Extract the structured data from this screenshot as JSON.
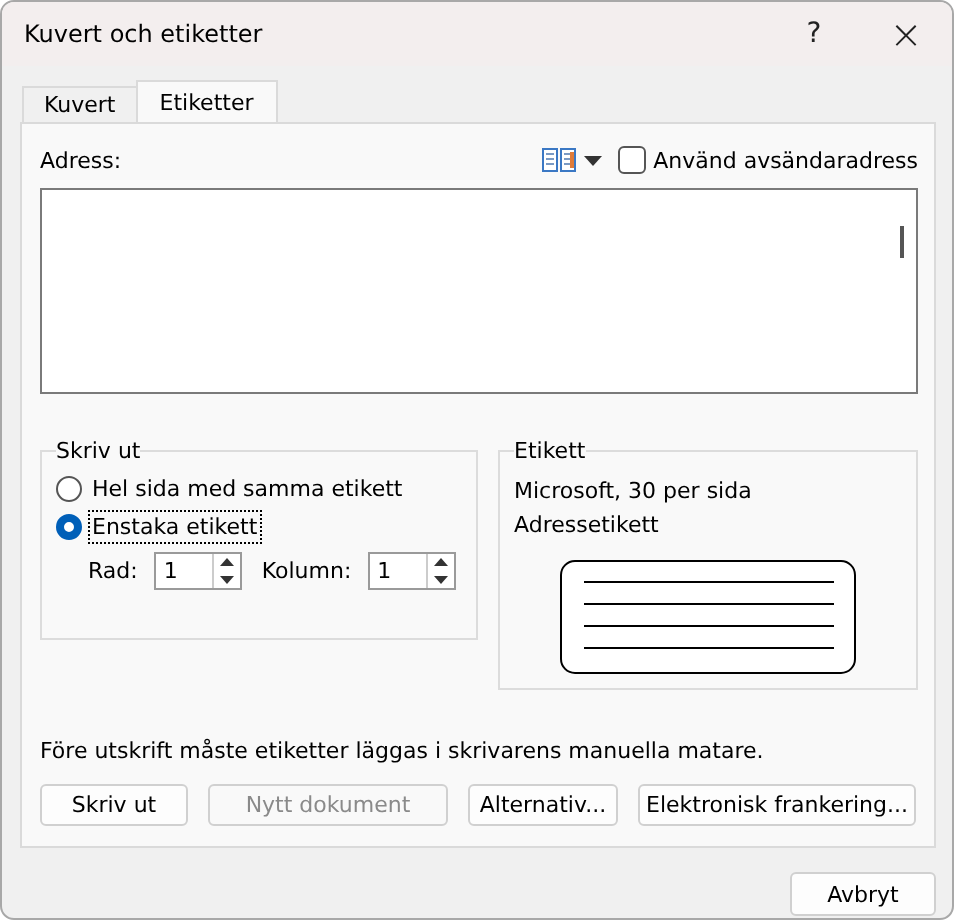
{
  "window": {
    "title": "Kuvert och etiketter",
    "help": "?",
    "close": "×"
  },
  "tabs": [
    {
      "label": "Kuvert",
      "selected": false
    },
    {
      "label": "Etiketter",
      "selected": true
    }
  ],
  "address": {
    "label": "Adress:",
    "use_return_address": {
      "label": "Använd avsändaradress",
      "checked": false
    }
  },
  "print": {
    "title": "Skriv ut",
    "options": [
      {
        "label": "Hel sida med samma etikett",
        "selected": false
      },
      {
        "label": "Enstaka etikett",
        "selected": true
      }
    ],
    "row": {
      "label": "Rad:",
      "value": "1"
    },
    "column": {
      "label": "Kolumn:",
      "value": "1"
    }
  },
  "label": {
    "title": "Etikett",
    "vendor": "Microsoft, 30 per sida",
    "type": "Adressetikett"
  },
  "note": "Före utskrift måste etiketter läggas i skrivarens manuella matare.",
  "buttons": [
    {
      "label": "Skriv ut",
      "disabled": false
    },
    {
      "label": "Nytt dokument",
      "disabled": true
    },
    {
      "label": "Alternativ...",
      "disabled": false
    },
    {
      "label": "Elektronisk frankering...",
      "disabled": false
    }
  ],
  "cancel": "Avbryt"
}
